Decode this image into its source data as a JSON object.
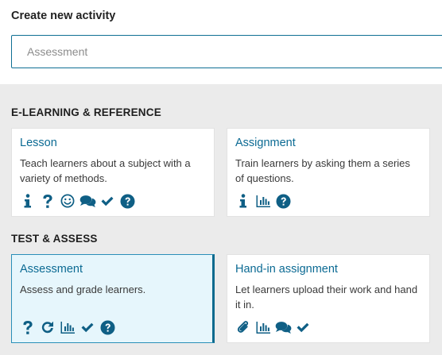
{
  "header": {
    "title": "Create new activity",
    "input_placeholder": "Assessment"
  },
  "sections": [
    {
      "title": "E-LEARNING & REFERENCE",
      "cards": [
        {
          "title": "Lesson",
          "description": "Teach learners about a subject with a variety of methods.",
          "selected": false,
          "icons": [
            "info-icon",
            "question-icon",
            "smiley-icon",
            "comments-icon",
            "check-icon",
            "help-circle-icon"
          ]
        },
        {
          "title": "Assignment",
          "description": "Train learners by asking them a series of questions.",
          "selected": false,
          "icons": [
            "info-icon",
            "bar-chart-icon",
            "help-circle-icon"
          ]
        }
      ]
    },
    {
      "title": "TEST & ASSESS",
      "cards": [
        {
          "title": "Assessment",
          "description": "Assess and grade learners.",
          "selected": true,
          "icons": [
            "question-icon",
            "refresh-icon",
            "bar-chart-icon",
            "check-icon",
            "help-circle-icon"
          ]
        },
        {
          "title": "Hand-in assignment",
          "description": "Let learners upload their work and hand it in.",
          "selected": false,
          "icons": [
            "paperclip-icon",
            "bar-chart-icon",
            "comments-icon",
            "check-icon"
          ]
        }
      ]
    }
  ],
  "colors": {
    "accent": "#0b6a93",
    "icon": "#0f5f85",
    "selected_bg": "#e6f6fc",
    "panel_bg": "#ebebeb"
  }
}
